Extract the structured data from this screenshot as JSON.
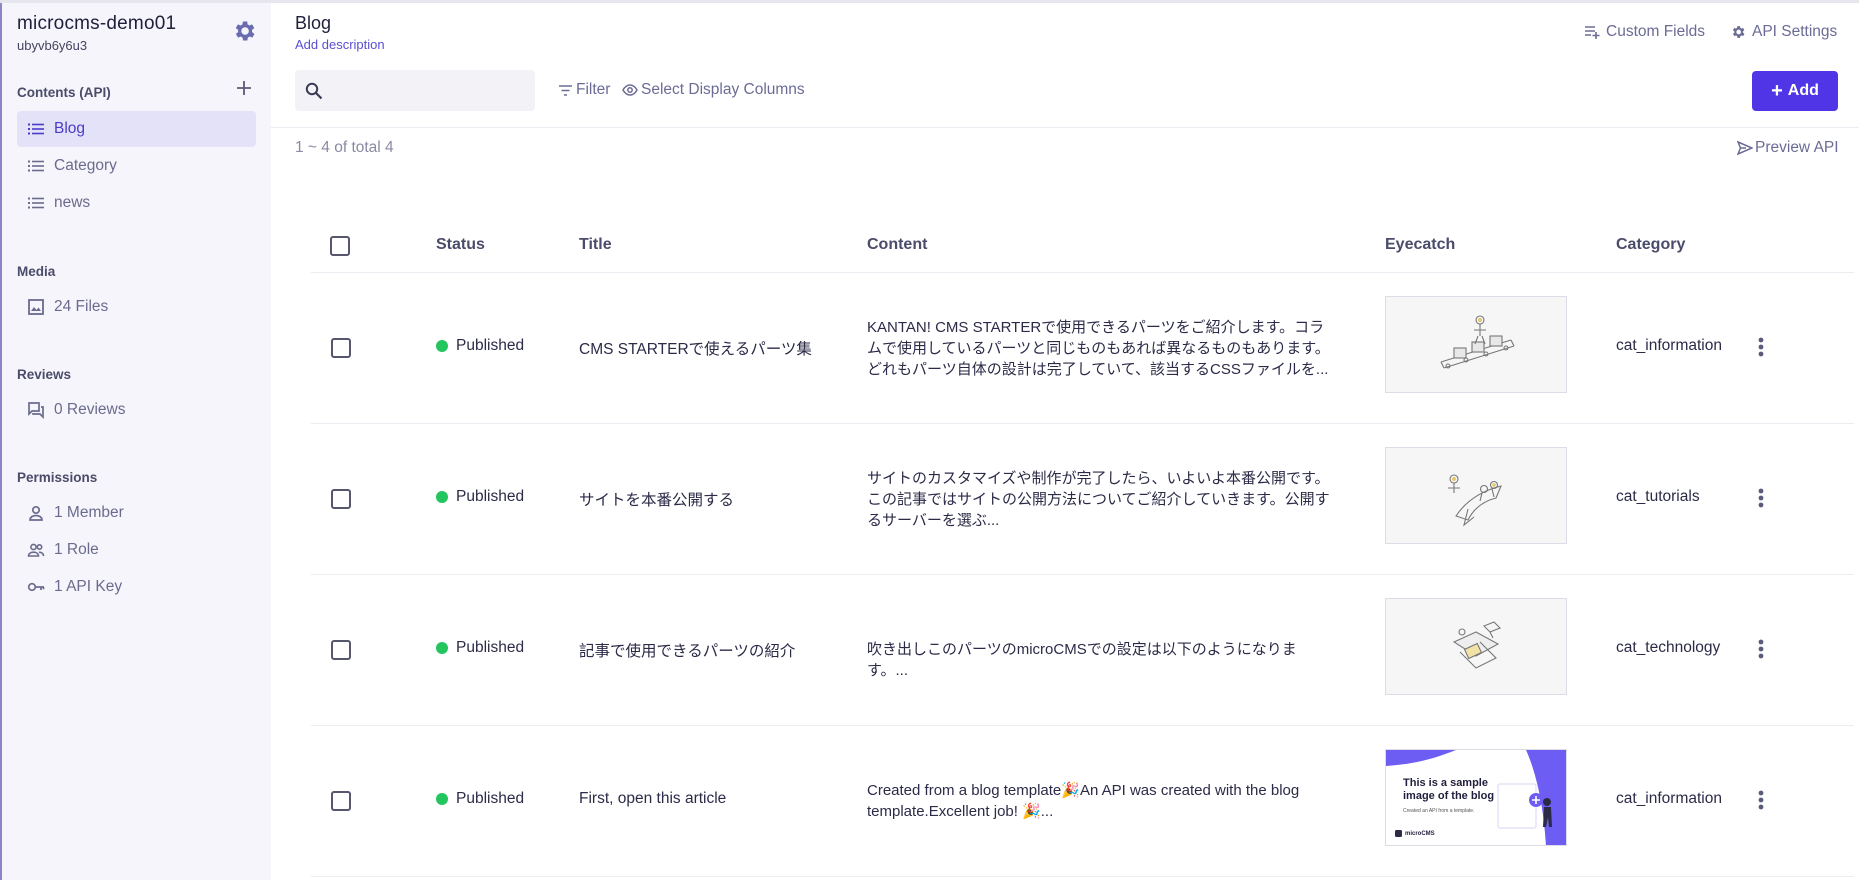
{
  "sidebar": {
    "project_name": "microcms-demo01",
    "project_id": "ubyvb6y6u3",
    "sections": {
      "contents": "Contents (API)",
      "media": "Media",
      "reviews": "Reviews",
      "permissions": "Permissions"
    },
    "apis": [
      {
        "label": "Blog",
        "icon": "list-icon"
      },
      {
        "label": "Category",
        "icon": "list-icon"
      },
      {
        "label": "news",
        "icon": "list-icon"
      }
    ],
    "media_files": "24 Files",
    "reviews_count": "0 Reviews",
    "permissions": {
      "member": "1 Member",
      "role": "1 Role",
      "api_key": "1 API Key"
    }
  },
  "header": {
    "title": "Blog",
    "description_link": "Add description",
    "custom_fields": "Custom Fields",
    "api_settings": "API Settings"
  },
  "toolbar": {
    "search_value": "",
    "filter": "Filter",
    "select_columns": "Select Display Columns",
    "add": "Add",
    "add_symbol": "+"
  },
  "summary": {
    "count": "1 ~ 4 of total 4",
    "preview": "Preview API"
  },
  "table": {
    "columns": [
      "Status",
      "Title",
      "Content",
      "Eyecatch",
      "Category"
    ],
    "rows": [
      {
        "status": "Published",
        "title": "CMS STARTERで使えるパーツ集",
        "content": "KANTAN! CMS STARTERで使用できるパーツをご紹介します。コラムで使用しているパーツと同じものもあれば異なるものもあります。どれもパーツ自体の設計は完了していて、該当するCSSファイルを...",
        "eyecatch": "illustration-conveyor",
        "category": "cat_information"
      },
      {
        "status": "Published",
        "title": "サイトを本番公開する",
        "content": "サイトのカスタマイズや制作が完了したら、いよいよ本番公開です。この記事ではサイトの公開方法についてご紹介していきます。公開するサーバーを選ぶ...",
        "eyecatch": "illustration-rocket",
        "category": "cat_tutorials"
      },
      {
        "status": "Published",
        "title": "記事で使用できるパーツの紹介",
        "content": "吹き出しこのパーツのmicroCMSでの設定は以下のようになります。...",
        "eyecatch": "illustration-devices",
        "category": "cat_technology"
      },
      {
        "status": "Published",
        "title": "First, open this article",
        "content": "Created from a blog template🎉An API was created with the blog template.Excellent job! 🎉...",
        "eyecatch": "sample-blog-image",
        "eyecatch_text": {
          "heading": "This is a sample image of the blog",
          "caption": "Created an API from a template.",
          "brand": "microCMS"
        },
        "category": "cat_information"
      }
    ]
  },
  "colors": {
    "accent": "#4f35e6",
    "published_dot": "#22c55e",
    "sidebar_bg": "#f5f5fb",
    "active_bg": "#e4e2f8"
  }
}
